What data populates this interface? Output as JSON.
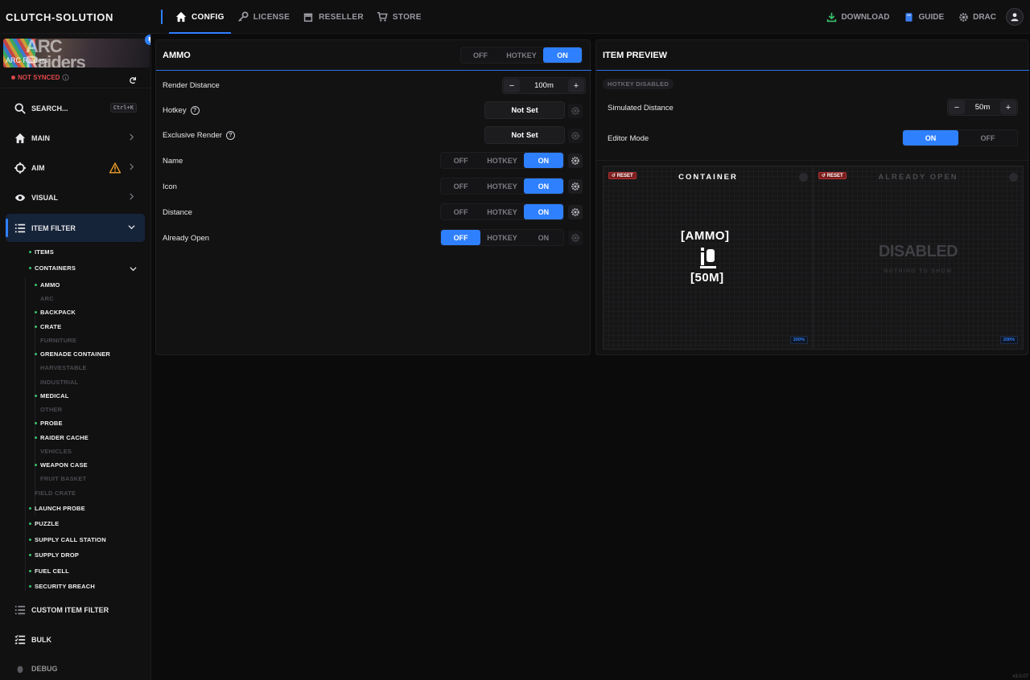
{
  "brand": "CLUTCH-SOLUTION",
  "nav": [
    {
      "label": "CONFIG",
      "icon": "home-icon",
      "active": true
    },
    {
      "label": "LICENSE",
      "icon": "key-icon"
    },
    {
      "label": "RESELLER",
      "icon": "store-icon"
    },
    {
      "label": "STORE",
      "icon": "cart-icon"
    }
  ],
  "nav_right": {
    "download": "DOWNLOAD",
    "guide": "GUIDE",
    "user": "DRAC"
  },
  "game": {
    "name": "ARC Raiders",
    "sync_status": "NOT SYNCED"
  },
  "sidebar": {
    "search": {
      "label": "SEARCH...",
      "shortcut": "Ctrl+K"
    },
    "main": "MAIN",
    "aim": "AIM",
    "visual": "VISUAL",
    "item_filter": "ITEM FILTER",
    "custom_item_filter": "CUSTOM ITEM FILTER",
    "bulk": "BULK",
    "debug": "DEBUG",
    "tree": {
      "items": "ITEMS",
      "containers": "CONTAINERS",
      "children": [
        {
          "label": "AMMO",
          "enabled": true
        },
        {
          "label": "ARC",
          "enabled": false
        },
        {
          "label": "BACKPACK",
          "enabled": true
        },
        {
          "label": "CRATE",
          "enabled": true
        },
        {
          "label": "FURNITURE",
          "enabled": false
        },
        {
          "label": "GRENADE CONTAINER",
          "enabled": true
        },
        {
          "label": "HARVESTABLE",
          "enabled": false
        },
        {
          "label": "INDUSTRIAL",
          "enabled": false
        },
        {
          "label": "MEDICAL",
          "enabled": true
        },
        {
          "label": "OTHER",
          "enabled": false
        },
        {
          "label": "PROBE",
          "enabled": true
        },
        {
          "label": "RAIDER CACHE",
          "enabled": true
        },
        {
          "label": "VEHICLES",
          "enabled": false
        },
        {
          "label": "WEAPON CASE",
          "enabled": true
        },
        {
          "label": "FRUIT BASKET",
          "enabled": false
        }
      ],
      "after": [
        {
          "label": "FIELD CRATE",
          "enabled": false
        },
        {
          "label": "LAUNCH PROBE",
          "enabled": true
        },
        {
          "label": "PUZZLE",
          "enabled": true
        },
        {
          "label": "SUPPLY CALL STATION",
          "enabled": true
        },
        {
          "label": "SUPPLY DROP",
          "enabled": true
        },
        {
          "label": "FUEL CELL",
          "enabled": true
        },
        {
          "label": "SECURITY BREACH",
          "enabled": true
        }
      ]
    }
  },
  "ammo_panel": {
    "title": "AMMO",
    "mode": {
      "off": "OFF",
      "hotkey": "HOTKEY",
      "on": "ON",
      "selected": "ON"
    },
    "render_distance": {
      "label": "Render Distance",
      "value": "100m"
    },
    "hotkey": {
      "label": "Hotkey",
      "value": "Not Set"
    },
    "exclusive_render": {
      "label": "Exclusive Render",
      "value": "Not Set"
    },
    "name": {
      "label": "Name",
      "selected": "ON"
    },
    "icon": {
      "label": "Icon",
      "selected": "ON"
    },
    "distance": {
      "label": "Distance",
      "selected": "ON"
    },
    "already_open": {
      "label": "Already Open",
      "selected": "OFF"
    },
    "opts": {
      "off": "OFF",
      "hotkey": "HOTKEY",
      "on": "ON"
    }
  },
  "preview": {
    "title": "ITEM PREVIEW",
    "badge": "HOTKEY DISABLED",
    "simulated_distance": {
      "label": "Simulated Distance",
      "value": "50m"
    },
    "editor_mode": {
      "label": "Editor Mode",
      "on": "ON",
      "off": "OFF",
      "selected": "ON"
    },
    "left": {
      "title": "CONTAINER",
      "reset": "RESET",
      "name": "[AMMO]",
      "distance": "[50M]",
      "zoom": "200%"
    },
    "right": {
      "title": "ALREADY OPEN",
      "reset": "RESET",
      "big": "DISABLED",
      "sub": "NOTHING TO SHOW",
      "zoom": "200%"
    }
  },
  "version": "v3.0.07",
  "colors": {
    "accent": "#2f80ff",
    "bg": "#0b0b0c",
    "danger": "#e0484a",
    "ok": "#3bc16b"
  }
}
